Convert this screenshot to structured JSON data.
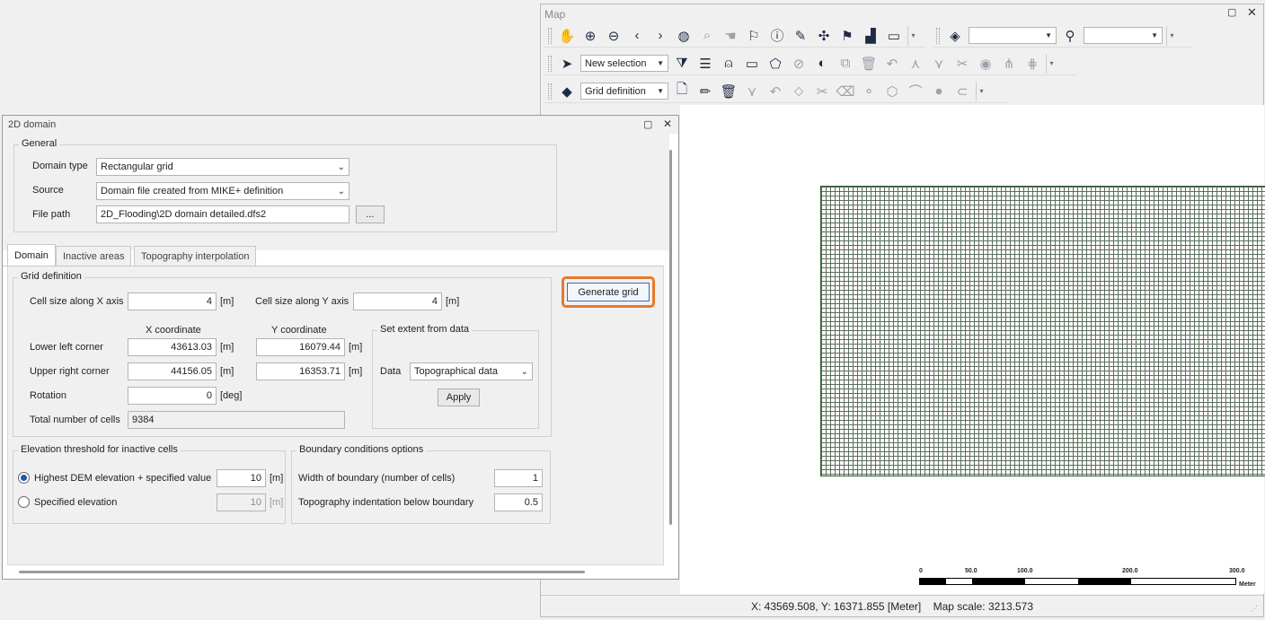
{
  "map": {
    "title": "Map",
    "toolbar1": {
      "icons": [
        "pan-icon",
        "zoom-in-icon",
        "zoom-out-icon",
        "back-icon",
        "forward-icon",
        "globe-icon",
        "zoom-extent-icon",
        "pan-select-icon",
        "clear-selection-icon",
        "info-icon",
        "edit-attributes-icon",
        "network-icon",
        "flag-icon",
        "chart-icon",
        "measure-icon"
      ],
      "layer_combo": "",
      "search_combo": ""
    },
    "toolbar2": {
      "selection_mode": "New selection"
    },
    "toolbar3": {
      "edit_target": "Grid definition"
    },
    "scale_bar": {
      "labels": [
        "0",
        "50.0",
        "100.0",
        "200.0",
        "300.0"
      ],
      "unit": "Meter"
    },
    "status": "X: 43569.508, Y: 16371.855 [Meter]    Map scale: 3213.573"
  },
  "dialog": {
    "title": "2D domain",
    "general": {
      "legend": "General",
      "domain_type_label": "Domain type",
      "domain_type": "Rectangular grid",
      "source_label": "Source",
      "source": "Domain file created from MIKE+ definition",
      "file_path_label": "File path",
      "file_path": "2D_Flooding\\2D domain detailed.dfs2",
      "browse": "..."
    },
    "tabs": [
      "Domain",
      "Inactive areas",
      "Topography interpolation"
    ],
    "grid": {
      "legend": "Grid definition",
      "cell_x_label": "Cell size along X axis",
      "cell_x": "4",
      "cell_y_label": "Cell size along Y axis",
      "cell_y": "4",
      "unit_m": "[m]",
      "unit_deg": "[deg]",
      "x_coord_label": "X coordinate",
      "y_coord_label": "Y coordinate",
      "lower_left_label": "Lower left corner",
      "ll_x": "43613.03",
      "ll_y": "16079.44",
      "upper_right_label": "Upper right corner",
      "ur_x": "44156.05",
      "ur_y": "16353.71",
      "rotation_label": "Rotation",
      "rotation": "0",
      "total_label": "Total number of cells",
      "total": "9384"
    },
    "extent": {
      "legend": "Set extent from data",
      "data_label": "Data",
      "data": "Topographical data",
      "apply": "Apply"
    },
    "generate_grid": "Generate grid",
    "elevation": {
      "legend": "Elevation threshold for inactive cells",
      "opt1": "Highest DEM elevation + specified value",
      "opt1_value": "10",
      "opt2": "Specified elevation",
      "opt2_value": "10",
      "unit": "[m]"
    },
    "boundary": {
      "legend": "Boundary conditions options",
      "width_label": "Width of boundary (number of cells)",
      "width": "1",
      "indent_label": "Topography indentation below boundary",
      "indent": "0.5"
    }
  },
  "colors": {
    "highlight": "#e8792b",
    "grid_line": "#2f5a2f"
  }
}
